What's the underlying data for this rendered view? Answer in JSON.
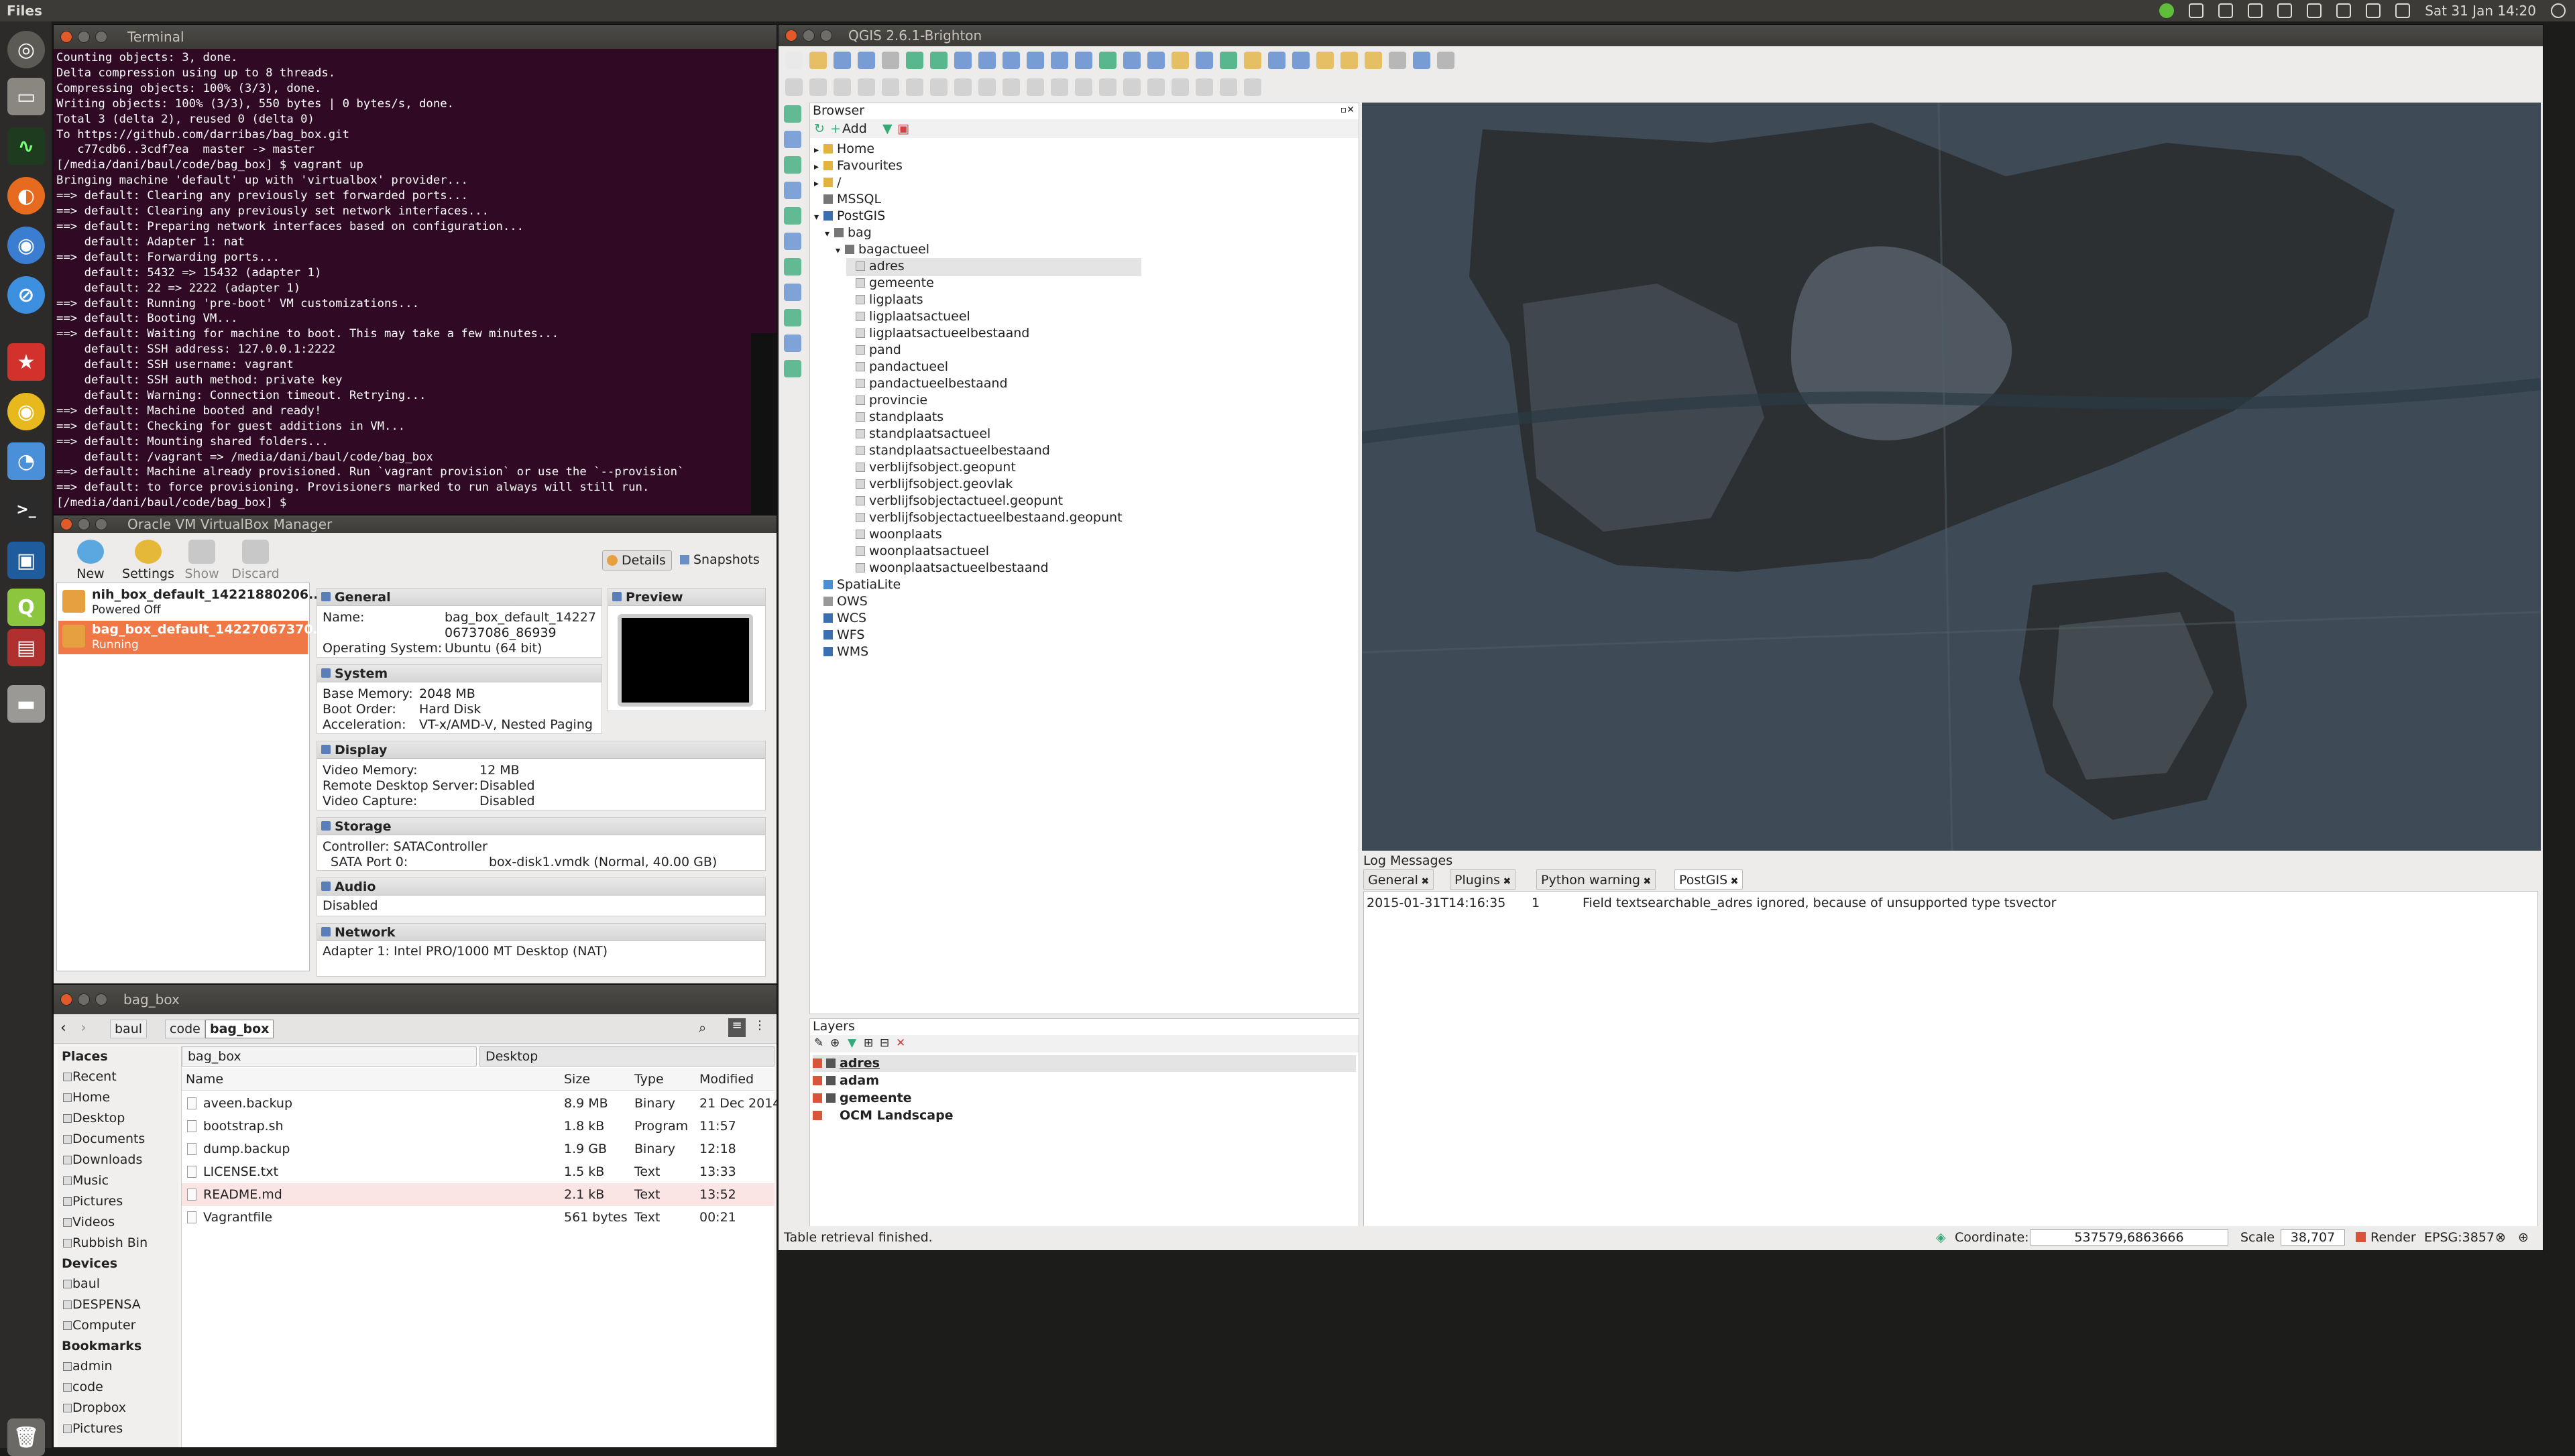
{
  "topbar": {
    "app": "Files",
    "clock": "Sat 31 Jan 14:20"
  },
  "launcher": {
    "icons": [
      "dash-icon",
      "files-icon",
      "monitor-icon",
      "firefox-icon",
      "chromium-icon",
      "safari-icon",
      "bookmark-icon",
      "chrome-icon",
      "chat-icon",
      "terminal-icon",
      "virtualbox-icon",
      "qgis-icon",
      "presentation-icon",
      "drive-icon",
      "trash-icon"
    ]
  },
  "terminal": {
    "title": "Terminal",
    "lines": [
      "Counting objects: 3, done.",
      "Delta compression using up to 8 threads.",
      "Compressing objects: 100% (3/3), done.",
      "Writing objects: 100% (3/3), 550 bytes | 0 bytes/s, done.",
      "Total 3 (delta 2), reused 0 (delta 0)",
      "To https://github.com/darribas/bag_box.git",
      "   c77cdb6..3cdf7ea  master -> master",
      "[/media/dani/baul/code/bag_box] $ vagrant up",
      "Bringing machine 'default' up with 'virtualbox' provider...",
      "==> default: Clearing any previously set forwarded ports...",
      "==> default: Clearing any previously set network interfaces...",
      "==> default: Preparing network interfaces based on configuration...",
      "    default: Adapter 1: nat",
      "==> default: Forwarding ports...",
      "    default: 5432 => 15432 (adapter 1)",
      "    default: 22 => 2222 (adapter 1)",
      "==> default: Running 'pre-boot' VM customizations...",
      "==> default: Booting VM...",
      "==> default: Waiting for machine to boot. This may take a few minutes...",
      "    default: SSH address: 127.0.0.1:2222",
      "    default: SSH username: vagrant",
      "    default: SSH auth method: private key",
      "    default: Warning: Connection timeout. Retrying...",
      "==> default: Machine booted and ready!",
      "==> default: Checking for guest additions in VM...",
      "==> default: Mounting shared folders...",
      "    default: /vagrant => /media/dani/baul/code/bag_box",
      "==> default: Machine already provisioned. Run `vagrant provision` or use the `--provision`",
      "==> default: to force provisioning. Provisioners marked to run always will still run.",
      "[/media/dani/baul/code/bag_box] $ "
    ]
  },
  "vbox": {
    "title": "Oracle VM VirtualBox Manager",
    "toolbar": {
      "new": "New",
      "settings": "Settings",
      "show": "Show",
      "discard": "Discard",
      "details": "Details",
      "snapshots": "Snapshots"
    },
    "vms": [
      {
        "name": "nih_box_default_14221880206...",
        "state": "Powered Off"
      },
      {
        "name": "bag_box_default_14227067370...",
        "state": "Running"
      }
    ],
    "general": {
      "title": "General",
      "name_k": "Name:",
      "name_v1": "bag_box_default_14227",
      "name_v2": "06737086_86939",
      "os_k": "Operating System:",
      "os_v": "Ubuntu (64 bit)"
    },
    "preview": {
      "title": "Preview"
    },
    "system": {
      "title": "System",
      "mem_k": "Base Memory:",
      "mem_v": "2048 MB",
      "boot_k": "Boot Order:",
      "boot_v": "Hard Disk",
      "acc_k": "Acceleration:",
      "acc_v": "VT-x/AMD-V, Nested Paging"
    },
    "display": {
      "title": "Display",
      "vmem_k": "Video Memory:",
      "vmem_v": "12 MB",
      "rds_k": "Remote Desktop Server:",
      "rds_v": "Disabled",
      "vc_k": "Video Capture:",
      "vc_v": "Disabled"
    },
    "storage": {
      "title": "Storage",
      "ctrl": "Controller: SATAController",
      "port_k": "SATA Port 0:",
      "port_v": "box-disk1.vmdk (Normal, 40.00 GB)"
    },
    "audio": {
      "title": "Audio",
      "val": "Disabled"
    },
    "network": {
      "title": "Network",
      "val": "Adapter 1:  Intel PRO/1000 MT Desktop (NAT)"
    }
  },
  "files": {
    "title": "bag_box",
    "path": [
      "baul",
      "code",
      "bag_box"
    ],
    "tabs": [
      "bag_box",
      "Desktop"
    ],
    "headers": {
      "name": "Name",
      "size": "Size",
      "type": "Type",
      "modified": "Modified"
    },
    "rows": [
      {
        "name": "aveen.backup",
        "size": "8.9 MB",
        "type": "Binary",
        "modified": "21 Dec 2014"
      },
      {
        "name": "bootstrap.sh",
        "size": "1.8 kB",
        "type": "Program",
        "modified": "11:57"
      },
      {
        "name": "dump.backup",
        "size": "1.9 GB",
        "type": "Binary",
        "modified": "12:18"
      },
      {
        "name": "LICENSE.txt",
        "size": "1.5 kB",
        "type": "Text",
        "modified": "13:33"
      },
      {
        "name": "README.md",
        "size": "2.1 kB",
        "type": "Text",
        "modified": "13:52"
      },
      {
        "name": "Vagrantfile",
        "size": "561 bytes",
        "type": "Text",
        "modified": "00:21"
      }
    ],
    "sidebar": {
      "places_h": "Places",
      "places": [
        "Recent",
        "Home",
        "Desktop",
        "Documents",
        "Downloads",
        "Music",
        "Pictures",
        "Videos",
        "Rubbish Bin"
      ],
      "devices_h": "Devices",
      "devices": [
        "baul",
        "DESPENSA",
        "Computer"
      ],
      "bookmarks_h": "Bookmarks",
      "bookmarks": [
        "admin",
        "code",
        "Dropbox",
        "Pictures"
      ]
    }
  },
  "qgis": {
    "title": "QGIS 2.6.1-Brighton",
    "browser": {
      "title": "Browser",
      "add": "Add",
      "items": [
        {
          "label": "Home",
          "depth": 0,
          "arrow": "▸"
        },
        {
          "label": "Favourites",
          "depth": 0,
          "arrow": "▸"
        },
        {
          "label": "/",
          "depth": 0,
          "arrow": "▸"
        },
        {
          "label": "MSSQL",
          "depth": 0,
          "arrow": ""
        },
        {
          "label": "PostGIS",
          "depth": 0,
          "arrow": "▾"
        },
        {
          "label": "bag",
          "depth": 1,
          "arrow": "▾"
        },
        {
          "label": "bagactueel",
          "depth": 2,
          "arrow": "▾"
        },
        {
          "label": "adres",
          "depth": 3,
          "arrow": ""
        },
        {
          "label": "gemeente",
          "depth": 3,
          "arrow": ""
        },
        {
          "label": "ligplaats",
          "depth": 3,
          "arrow": ""
        },
        {
          "label": "ligplaatsactueel",
          "depth": 3,
          "arrow": ""
        },
        {
          "label": "ligplaatsactueelbestaand",
          "depth": 3,
          "arrow": ""
        },
        {
          "label": "pand",
          "depth": 3,
          "arrow": ""
        },
        {
          "label": "pandactueel",
          "depth": 3,
          "arrow": ""
        },
        {
          "label": "pandactueelbestaand",
          "depth": 3,
          "arrow": ""
        },
        {
          "label": "provincie",
          "depth": 3,
          "arrow": ""
        },
        {
          "label": "standplaats",
          "depth": 3,
          "arrow": ""
        },
        {
          "label": "standplaatsactueel",
          "depth": 3,
          "arrow": ""
        },
        {
          "label": "standplaatsactueelbestaand",
          "depth": 3,
          "arrow": ""
        },
        {
          "label": "verblijfsobject.geopunt",
          "depth": 3,
          "arrow": ""
        },
        {
          "label": "verblijfsobject.geovlak",
          "depth": 3,
          "arrow": ""
        },
        {
          "label": "verblijfsobjectactueel.geopunt",
          "depth": 3,
          "arrow": ""
        },
        {
          "label": "verblijfsobjectactueelbestaand.geopunt",
          "depth": 3,
          "arrow": ""
        },
        {
          "label": "woonplaats",
          "depth": 3,
          "arrow": ""
        },
        {
          "label": "woonplaatsactueel",
          "depth": 3,
          "arrow": ""
        },
        {
          "label": "woonplaatsactueelbestaand",
          "depth": 3,
          "arrow": ""
        },
        {
          "label": "SpatiaLite",
          "depth": 0,
          "arrow": ""
        },
        {
          "label": "OWS",
          "depth": 0,
          "arrow": ""
        },
        {
          "label": "WCS",
          "depth": 0,
          "arrow": ""
        },
        {
          "label": "WFS",
          "depth": 0,
          "arrow": ""
        },
        {
          "label": "WMS",
          "depth": 0,
          "arrow": ""
        }
      ]
    },
    "layers": {
      "title": "Layers",
      "items": [
        "adres",
        "adam",
        "gemeente",
        "OCM Landscape"
      ]
    },
    "log": {
      "title": "Log Messages",
      "tabs": [
        "General",
        "Plugins",
        "Python warning",
        "PostGIS"
      ],
      "entry": {
        "time": "2015-01-31T14:16:35",
        "level": "1",
        "msg": "Field textsearchable_adres ignored, because of unsupported type tsvector"
      }
    },
    "status": {
      "msg": "Table retrieval finished.",
      "coord_label": "Coordinate:",
      "coord": "537579,6863666",
      "scale_label": "Scale",
      "scale": "38,707",
      "render": "Render",
      "epsg": "EPSG:3857"
    }
  }
}
